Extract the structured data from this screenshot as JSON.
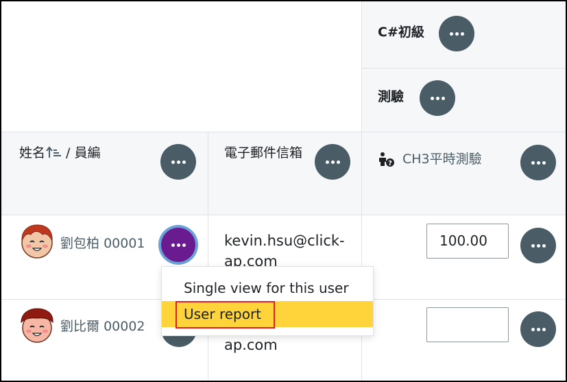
{
  "columns": {
    "course_name": "C#初級",
    "category_name": "測驗",
    "name_header": "姓名",
    "id_header": "員編",
    "separator": " / ",
    "email_header": "電子郵件信箱",
    "grade_item": "CH3平時測驗"
  },
  "rows": [
    {
      "name": "劉包柏",
      "id": "00001",
      "email_line1": "kevin.hsu@click-",
      "email_line2": "ap.com",
      "grade": "100.00"
    },
    {
      "name": "劉比爾",
      "id": "00002",
      "email_line1": "",
      "email_line2": "ap.com",
      "grade": ""
    }
  ],
  "menu": {
    "item1": "Single view for this user",
    "item2": "User report"
  },
  "colors": {
    "dots_button": "#4a5d66",
    "active_button": "#6a1b8f",
    "highlight": "#ffd43b",
    "annotation": "#e02020"
  },
  "icons": {
    "sort": "sort-ascending-icon",
    "grade_item": "person-question-icon",
    "actions": "ellipsis-icon"
  }
}
